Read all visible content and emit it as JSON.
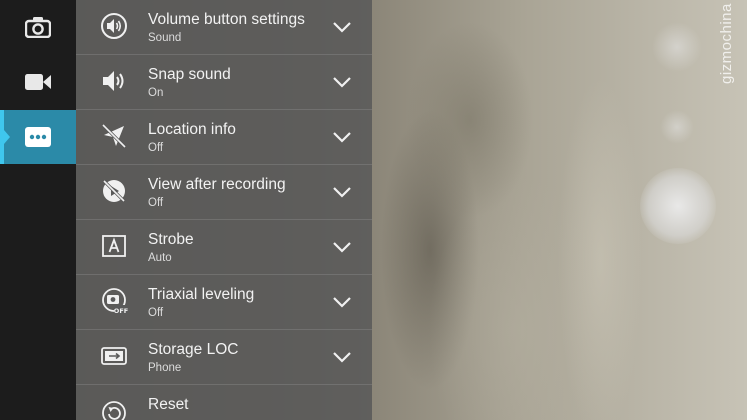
{
  "watermark": "gizmochina",
  "mode_rail": {
    "items": [
      {
        "icon": "camera-icon",
        "active": false
      },
      {
        "icon": "video-camera-icon",
        "active": false
      },
      {
        "icon": "more-options-icon",
        "active": true
      }
    ],
    "accent_color": "#2b8aa8"
  },
  "settings": {
    "items": [
      {
        "title": "Volume button settings",
        "value": "Sound",
        "icon": "volume-key-icon"
      },
      {
        "title": "Snap sound",
        "value": "On",
        "icon": "speaker-icon"
      },
      {
        "title": "Location info",
        "value": "Off",
        "icon": "location-off-icon"
      },
      {
        "title": "View after recording",
        "value": "Off",
        "icon": "review-off-icon"
      },
      {
        "title": "Strobe",
        "value": "Auto",
        "icon": "strobe-icon"
      },
      {
        "title": "Triaxial leveling",
        "value": "Off",
        "icon": "leveling-icon"
      },
      {
        "title": "Storage LOC",
        "value": "Phone",
        "icon": "storage-icon"
      },
      {
        "title": "Reset",
        "value": "",
        "icon": "reset-icon"
      }
    ]
  }
}
